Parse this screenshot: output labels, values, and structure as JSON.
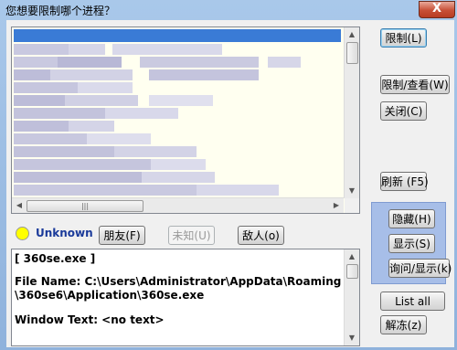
{
  "window": {
    "title": "您想要限制哪个进程？",
    "close_glyph": "X"
  },
  "process_list": {
    "content_note": ""
  },
  "status": {
    "label": "Unknown",
    "indicator_color": "#ffff00"
  },
  "classify_buttons": {
    "friend": "朋友(F)",
    "unknown": "未知(U)",
    "enemy": "敌人(o)"
  },
  "details": {
    "lines": [
      "[ 360se.exe ]",
      "File Name: C:\\Users\\Administrator\\AppData\\Roaming",
      "\\360se6\\Application\\360se.exe",
      "Window Text: <no text>"
    ]
  },
  "right_buttons": {
    "restrict": "限制(L)",
    "restrict_view": "限制/查看(W)",
    "close": "关闭(C)",
    "refresh": "刷新 (F5)",
    "hide": "隐藏(H)",
    "show": "显示(S)",
    "ask_show": "询问/显示(k)",
    "list_all": "List all",
    "unfreeze": "解冻(z)"
  }
}
